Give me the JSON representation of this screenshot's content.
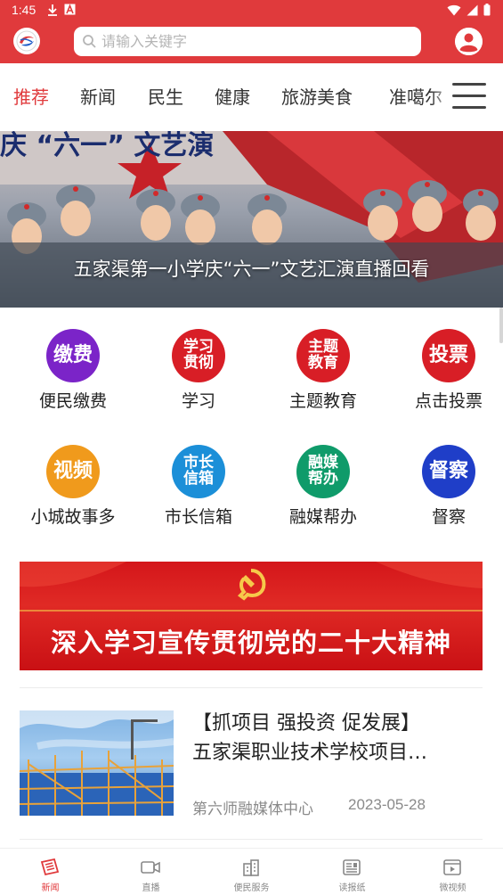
{
  "status_bar": {
    "time": "1:45"
  },
  "search": {
    "placeholder": "请输入关键字"
  },
  "tabs": [
    {
      "label": "推荐",
      "active": true
    },
    {
      "label": "新闻"
    },
    {
      "label": "民生"
    },
    {
      "label": "健康"
    },
    {
      "label": "旅游美食"
    },
    {
      "label": "准噶尔"
    }
  ],
  "banner": {
    "caption": "五家渠第一小学庆“六一”文艺汇演直播回看",
    "scene_text": "庆 “六一” 文艺演"
  },
  "services": [
    {
      "icon_text": "缴费",
      "label": "便民缴费",
      "color": "#7b24c8"
    },
    {
      "icon_text": "学习\n贯彻",
      "label": "学习",
      "color": "#d81e26"
    },
    {
      "icon_text": "主题\n教育",
      "label": "主题教育",
      "color": "#d81e26"
    },
    {
      "icon_text": "投票",
      "label": "点击投票",
      "color": "#d81e26"
    },
    {
      "icon_text": "视频",
      "label": "小城故事多",
      "color": "#f09a1c"
    },
    {
      "icon_text": "市长\n信箱",
      "label": "市长信箱",
      "color": "#1b8fd8"
    },
    {
      "icon_text": "融媒\n帮办",
      "label": "融媒帮办",
      "color": "#0f9b6a"
    },
    {
      "icon_text": "督察",
      "label": "督察",
      "color": "#1f3ec8"
    }
  ],
  "promo": {
    "text": "深入学习宣传贯彻党的二十大精神"
  },
  "news": [
    {
      "title_line1": "【抓项目 强投资 促发展】",
      "title_line2": "五家渠职业技术学校项目…",
      "source": "第六师融媒体中心",
      "date": "2023-05-28"
    }
  ],
  "bottom_nav": [
    {
      "label": "新闻",
      "icon": "news-icon",
      "active": true
    },
    {
      "label": "直播",
      "icon": "camera-icon"
    },
    {
      "label": "便民服务",
      "icon": "building-icon"
    },
    {
      "label": "读报纸",
      "icon": "newspaper-icon"
    },
    {
      "label": "微视频",
      "icon": "video-icon"
    }
  ],
  "colors": {
    "brand": "#e03a3c",
    "text": "#222222",
    "muted": "#8a8a8a"
  }
}
